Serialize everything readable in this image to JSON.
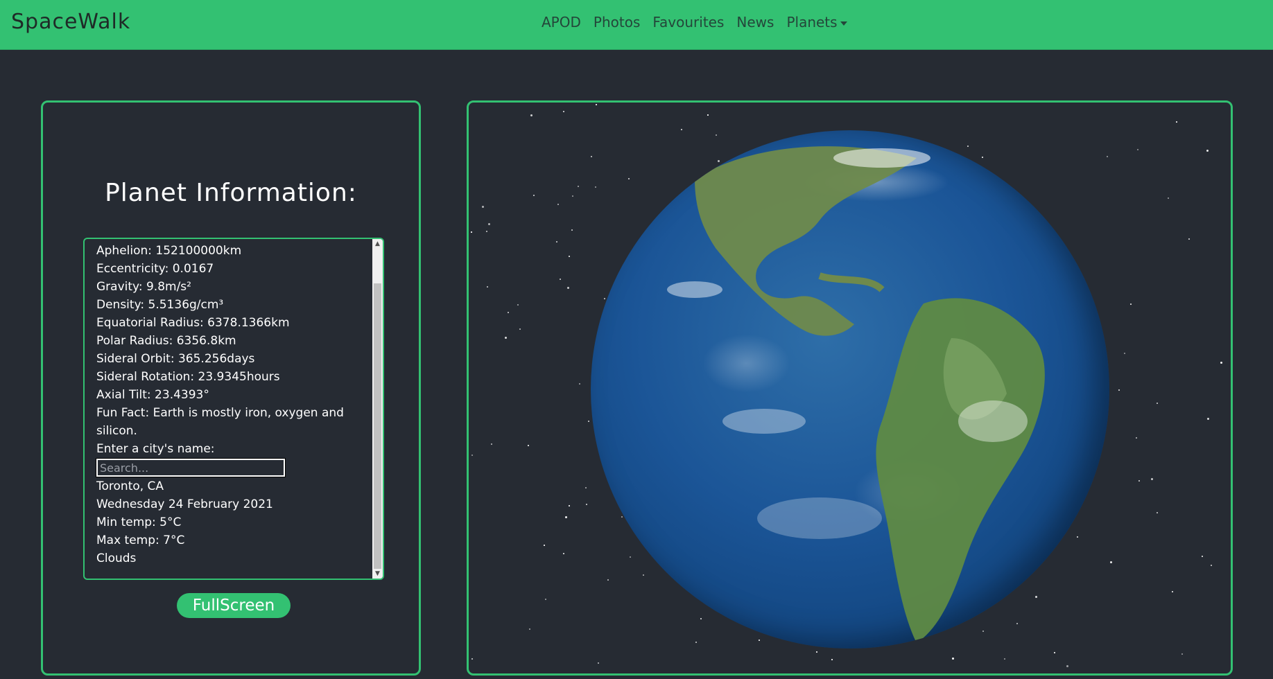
{
  "navbar": {
    "brand": "SpaceWalk",
    "links": [
      "APOD",
      "Photos",
      "Favourites",
      "News"
    ],
    "dropdown_label": "Planets"
  },
  "info": {
    "title": "Planet Information:",
    "lines": [
      "Aphelion: 152100000km",
      "Eccentricity: 0.0167",
      "Gravity: 9.8m/s²",
      "Density: 5.5136g/cm³",
      "Equatorial Radius: 6378.1366km",
      "Polar Radius: 6356.8km",
      "Sideral Orbit: 365.256days",
      "Sideral Rotation: 23.9345hours",
      "Axial Tilt: 23.4393°",
      "Fun Fact: Earth is mostly iron, oxygen and silicon."
    ],
    "city_prompt": "Enter a city's name:",
    "search_placeholder": "Search...",
    "weather": {
      "location": "Toronto, CA",
      "date": "Wednesday 24 February 2021",
      "min_temp": "Min temp: 5°C",
      "max_temp": "Max temp: 7°C",
      "conditions": "Clouds"
    },
    "fullscreen_label": "FullScreen"
  },
  "colors": {
    "accent": "#33c172",
    "background": "#262b33"
  }
}
